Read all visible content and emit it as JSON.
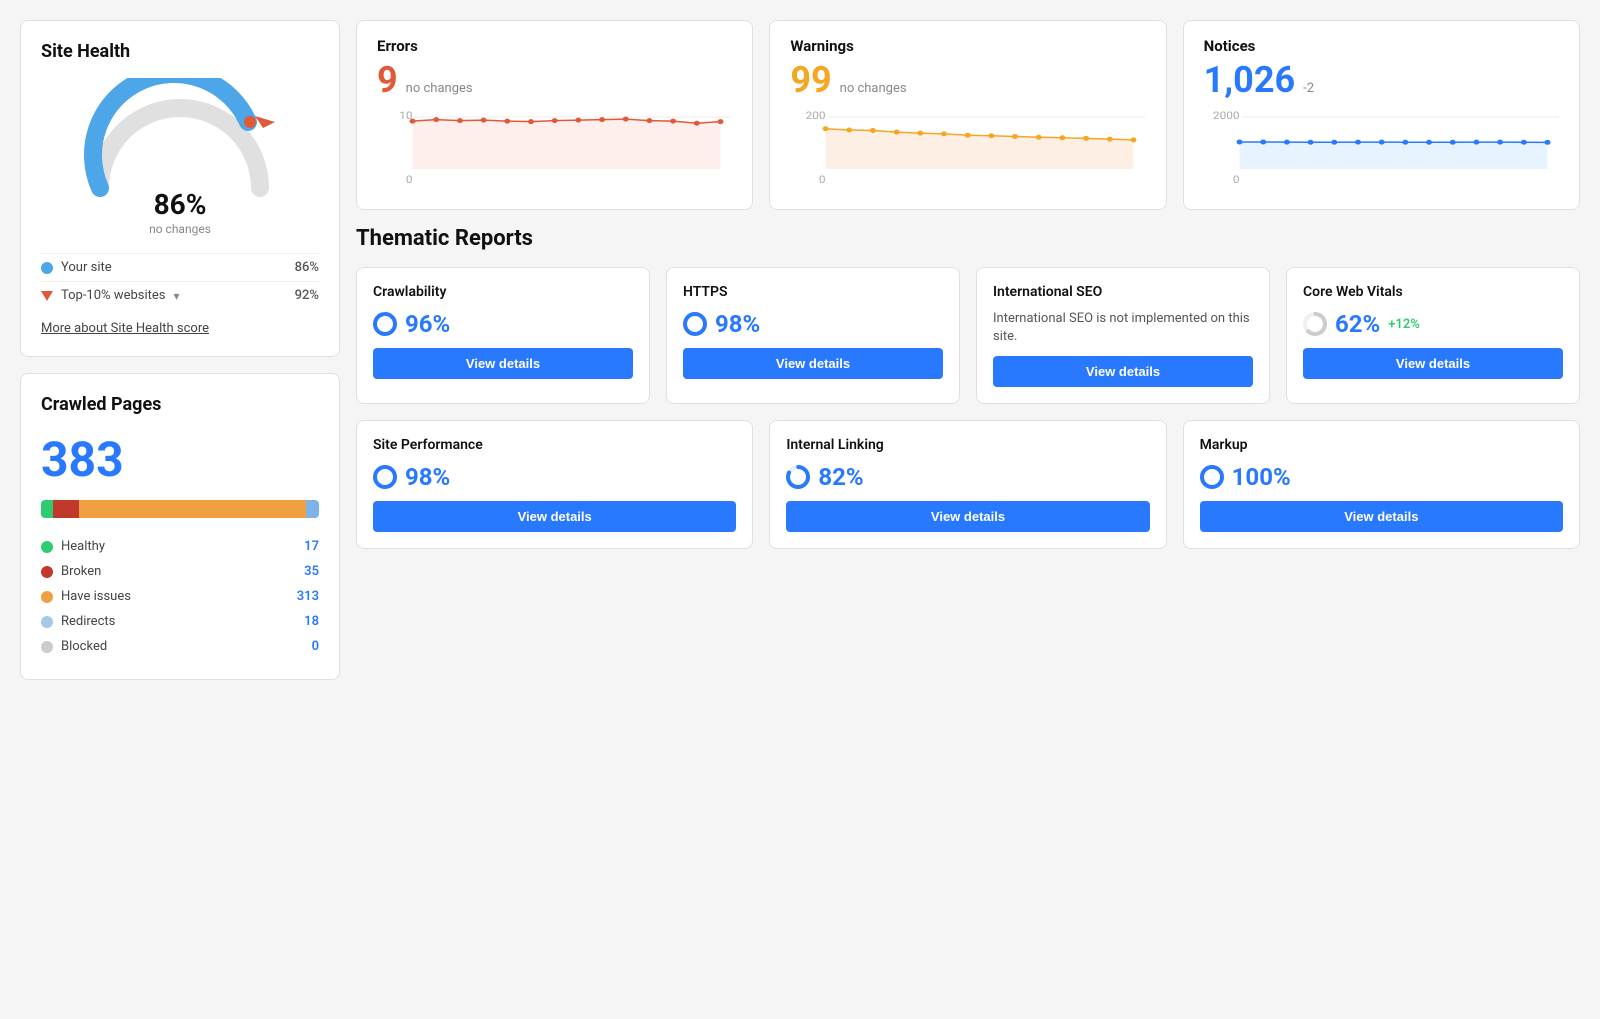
{
  "site_health": {
    "title": "Site Health",
    "percent": "86%",
    "subtext": "no changes",
    "your_site_label": "Your site",
    "your_site_value": "86%",
    "your_site_color": "#4da6e8",
    "top10_label": "Top-10% websites",
    "top10_value": "92%",
    "top10_color": "#e05a3a",
    "more_link": "More about Site Health score"
  },
  "crawled_pages": {
    "title": "Crawled Pages",
    "count": "383",
    "bar_segments": [
      {
        "color": "#2ecc71",
        "width": 4.4
      },
      {
        "color": "#c0392b",
        "width": 9.1
      },
      {
        "color": "#f0a040",
        "width": 81.7
      },
      {
        "color": "#7fb3e8",
        "width": 4.7
      }
    ],
    "legend": [
      {
        "label": "Healthy",
        "color": "#2ecc71",
        "value": "17"
      },
      {
        "label": "Broken",
        "color": "#c0392b",
        "value": "35"
      },
      {
        "label": "Have issues",
        "color": "#f0a040",
        "value": "313"
      },
      {
        "label": "Redirects",
        "color": "#a8c8e8",
        "value": "18"
      },
      {
        "label": "Blocked",
        "color": "#cccccc",
        "value": "0"
      }
    ]
  },
  "errors": {
    "label": "Errors",
    "number": "9",
    "change": "no changes",
    "color": "#e05a3a",
    "chart_max": 10,
    "chart_min": 0,
    "chart_color": "#e05a3a",
    "chart_fill": "#fde8e4",
    "chart_points": [
      9.2,
      9.5,
      9.3,
      9.4,
      9.2,
      9.1,
      9.3,
      9.4,
      9.5,
      9.6,
      9.3,
      9.2,
      8.8,
      9.1
    ]
  },
  "warnings": {
    "label": "Warnings",
    "number": "99",
    "change": "no changes",
    "color": "#f5a623",
    "chart_max": 200,
    "chart_min": 0,
    "chart_color": "#f5a623",
    "chart_fill": "#fde8d8",
    "chart_points": [
      155,
      150,
      148,
      142,
      138,
      135,
      130,
      128,
      125,
      122,
      120,
      118,
      115,
      112
    ]
  },
  "notices": {
    "label": "Notices",
    "number": "1,026",
    "change": "-2",
    "color": "#2979ff",
    "chart_max": 2000,
    "chart_min": 0,
    "chart_color": "#2979ff",
    "chart_fill": "#ddeeff",
    "chart_points": [
      1040,
      1038,
      1035,
      1030,
      1028,
      1032,
      1035,
      1030,
      1028,
      1029,
      1032,
      1033,
      1028,
      1026
    ]
  },
  "thematic_reports": {
    "title": "Thematic Reports",
    "top_row": [
      {
        "id": "crawlability",
        "title": "Crawlability",
        "score": "96%",
        "score_color": "#2979ff",
        "change": "",
        "desc": "",
        "button": "View details",
        "donut_color": "#2979ff",
        "donut_bg": "#e8f0ff"
      },
      {
        "id": "https",
        "title": "HTTPS",
        "score": "98%",
        "score_color": "#2979ff",
        "change": "",
        "desc": "",
        "button": "View details",
        "donut_color": "#2979ff",
        "donut_bg": "#e8f0ff"
      },
      {
        "id": "international-seo",
        "title": "International SEO",
        "score": "",
        "score_color": "#2979ff",
        "change": "",
        "desc": "International SEO is not implemented on this site.",
        "button": "View details",
        "donut_color": "#cccccc",
        "donut_bg": "#f0f0f0"
      },
      {
        "id": "core-web-vitals",
        "title": "Core Web Vitals",
        "score": "62%",
        "score_color": "#2979ff",
        "change": "+12%",
        "desc": "",
        "button": "View details",
        "donut_color": "#cccccc",
        "donut_bg": "#f0f0f0"
      }
    ],
    "bottom_row": [
      {
        "id": "site-performance",
        "title": "Site Performance",
        "score": "98%",
        "score_color": "#2979ff",
        "change": "",
        "desc": "",
        "button": "View details",
        "donut_color": "#2979ff",
        "donut_bg": "#e8f0ff"
      },
      {
        "id": "internal-linking",
        "title": "Internal Linking",
        "score": "82%",
        "score_color": "#2979ff",
        "change": "",
        "desc": "",
        "button": "View details",
        "donut_color": "#2979ff",
        "donut_bg": "#e8f0ff"
      },
      {
        "id": "markup",
        "title": "Markup",
        "score": "100%",
        "score_color": "#2979ff",
        "change": "",
        "desc": "",
        "button": "View details",
        "donut_color": "#2979ff",
        "donut_bg": "#e8f0ff"
      }
    ]
  }
}
